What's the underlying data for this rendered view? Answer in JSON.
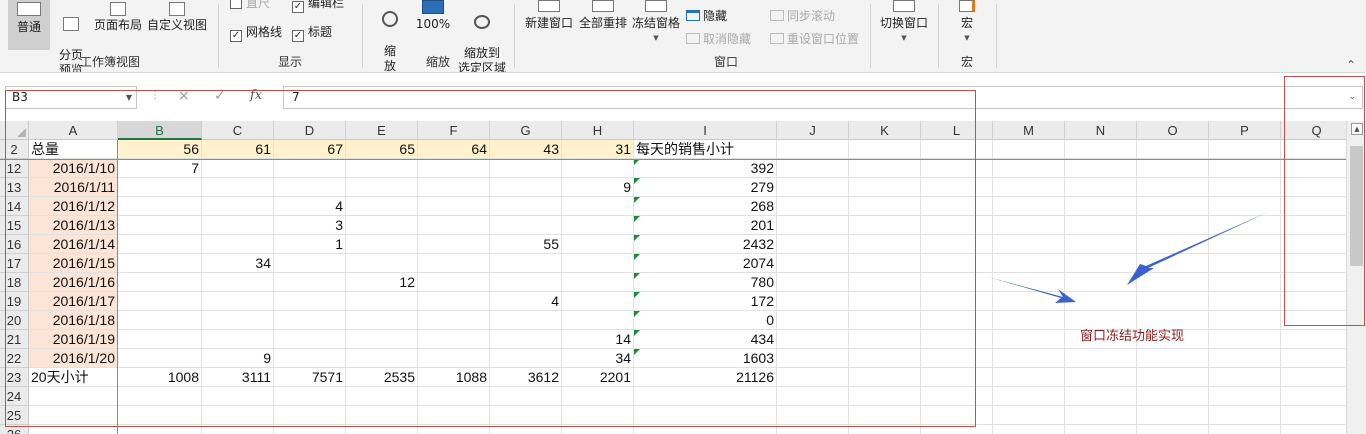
{
  "ribbon": {
    "workbook_views": {
      "normal": "普通",
      "page_break": "分页\n预览",
      "page_layout": "页面布局",
      "custom_views": "自定义视图",
      "group_label": "工作簿视图"
    },
    "show": {
      "ruler": "直尺",
      "formula_bar": "编辑栏",
      "gridlines": "网格线",
      "headings": "标题",
      "group_label": "显示"
    },
    "zoom": {
      "zoom": "缩\n放",
      "zoom100": "100%",
      "zoom_selection": "缩放到\n选定区域",
      "group_label": "缩放"
    },
    "window": {
      "new_window": "新建窗口",
      "arrange_all": "全部重排",
      "freeze_panes": "冻结窗格",
      "hide": "隐藏",
      "unhide": "取消隐藏",
      "sync_scroll": "同步滚动",
      "reset_position": "重设窗口位置",
      "switch_windows": "切换窗口",
      "group_label": "窗口"
    },
    "macros": {
      "macros": "宏",
      "group_label": "宏"
    }
  },
  "formula_bar": {
    "name_box": "B3",
    "cancel_icon": "×",
    "enter_icon": "✓",
    "fx": "fx",
    "formula": "7"
  },
  "columns": [
    "A",
    "B",
    "C",
    "D",
    "E",
    "F",
    "G",
    "H",
    "I",
    "J",
    "K",
    "L",
    "M",
    "N",
    "O",
    "P",
    "Q"
  ],
  "selected_column": "B",
  "rows": [
    {
      "num": "2",
      "cells": [
        "总量",
        "56",
        "61",
        "67",
        "65",
        "64",
        "43",
        "31",
        "每天的销售小计"
      ]
    },
    {
      "num": "12",
      "cells": [
        "2016/1/10",
        "7",
        "",
        "",
        "",
        "",
        "",
        "",
        "392"
      ]
    },
    {
      "num": "13",
      "cells": [
        "2016/1/11",
        "",
        "",
        "",
        "",
        "",
        "",
        "9",
        "279"
      ]
    },
    {
      "num": "14",
      "cells": [
        "2016/1/12",
        "",
        "",
        "4",
        "",
        "",
        "",
        "",
        "268"
      ]
    },
    {
      "num": "15",
      "cells": [
        "2016/1/13",
        "",
        "",
        "3",
        "",
        "",
        "",
        "",
        "201"
      ]
    },
    {
      "num": "16",
      "cells": [
        "2016/1/14",
        "",
        "",
        "1",
        "",
        "",
        "55",
        "",
        "2432"
      ]
    },
    {
      "num": "17",
      "cells": [
        "2016/1/15",
        "",
        "34",
        "",
        "",
        "",
        "",
        "",
        "2074"
      ]
    },
    {
      "num": "18",
      "cells": [
        "2016/1/16",
        "",
        "",
        "",
        "12",
        "",
        "",
        "",
        "780"
      ]
    },
    {
      "num": "19",
      "cells": [
        "2016/1/17",
        "",
        "",
        "",
        "",
        "",
        "4",
        "",
        "172"
      ]
    },
    {
      "num": "20",
      "cells": [
        "2016/1/18",
        "",
        "",
        "",
        "",
        "",
        "",
        "",
        "0"
      ]
    },
    {
      "num": "21",
      "cells": [
        "2016/1/19",
        "",
        "",
        "",
        "",
        "",
        "",
        "14",
        "434"
      ]
    },
    {
      "num": "22",
      "cells": [
        "2016/1/20",
        "",
        "9",
        "",
        "",
        "",
        "",
        "34",
        "1603"
      ]
    },
    {
      "num": "23",
      "cells": [
        "20天小计",
        "1008",
        "3111",
        "7571",
        "2535",
        "1088",
        "3612",
        "2201",
        "21126"
      ]
    },
    {
      "num": "24",
      "cells": [
        "",
        "",
        "",
        "",
        "",
        "",
        "",
        "",
        ""
      ]
    },
    {
      "num": "25",
      "cells": [
        "",
        "",
        "",
        "",
        "",
        "",
        "",
        "",
        ""
      ]
    },
    {
      "num": "26",
      "cells": [
        "",
        "",
        "",
        "",
        "",
        "",
        "",
        "",
        ""
      ]
    }
  ],
  "annotation": "窗口冻结功能实现",
  "colors": {
    "date_fill": "#fce4d6",
    "header_fill": "#fff2cc",
    "annotation_box": "#c0504d",
    "arrow": "#3b5fcf",
    "excel_green": "#217346"
  }
}
